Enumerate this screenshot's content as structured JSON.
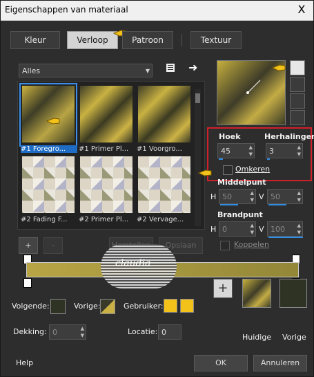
{
  "window": {
    "title": "Eigenschappen van materiaal",
    "close": "X"
  },
  "tabs": [
    {
      "label": "Kleur"
    },
    {
      "label": "Verloop"
    },
    {
      "label": "Patroon"
    },
    {
      "label": "Textuur"
    }
  ],
  "category": {
    "value": "Alles"
  },
  "gallery": {
    "items": [
      {
        "caption": "#1 Foregro...",
        "selected": true
      },
      {
        "caption": "#1 Primer Pl..."
      },
      {
        "caption": "#1 Voorgro..."
      },
      {
        "caption": "#2 Fading F..."
      },
      {
        "caption": "#2 Primer Pl..."
      },
      {
        "caption": "#2 Vervage..."
      }
    ]
  },
  "gallery_buttons": {
    "add": "+",
    "remove": "-",
    "reset": "Herstellen",
    "save": "Opslaan"
  },
  "settings": {
    "angle_label": "Hoek",
    "angle_value": "45",
    "repeats_label": "Herhalingen",
    "repeats_value": "3",
    "invert_label": "Omkeren",
    "center_label": "Middelpunt",
    "h_label": "H",
    "v_label": "V",
    "center_h": "50",
    "center_v": "50",
    "focal_label": "Brandpunt",
    "focal_h": "0",
    "focal_v": "100",
    "link_label": "Koppelen"
  },
  "stops": {
    "next_label": "Volgende:",
    "prev_label": "Vorige:",
    "user_label": "Gebruiker:",
    "opacity_label": "Dekking:",
    "opacity_value": "0",
    "location_label": "Locatie:",
    "location_value": "0"
  },
  "swatches": {
    "current_label": "Huidige",
    "previous_label": "Vorige",
    "add": "+"
  },
  "footer": {
    "help": "Help",
    "ok": "OK",
    "cancel": "Annuleren"
  },
  "watermark": {
    "text": "claudia"
  },
  "colors": {
    "gold": "#c9b143",
    "dark_olive": "#3d3d29",
    "selection_blue": "#1e6cc4",
    "highlight_red": "#d2202a",
    "user_yellow": "#f2c21a"
  },
  "icons": [
    "close-icon",
    "book-icon",
    "arrow-right-icon",
    "pointer-hand-icon",
    "chevron-down-icon",
    "spin-arrows-icon",
    "style-linear-icon",
    "style-rectangular-icon",
    "style-sunburst-icon",
    "style-radial-icon"
  ]
}
